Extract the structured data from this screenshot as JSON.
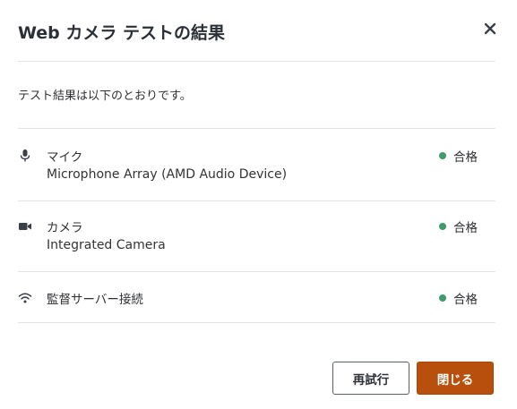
{
  "dialog": {
    "title": "Web カメラ テストの結果",
    "intro": "テスト結果は以下のとおりです。",
    "results": [
      {
        "label": "マイク",
        "device": "Microphone Array (AMD Audio Device)",
        "status": "合格",
        "icon": "microphone-icon"
      },
      {
        "label": "カメラ",
        "device": "Integrated Camera",
        "status": "合格",
        "icon": "video-camera-icon"
      },
      {
        "label": "監督サーバー接続",
        "status": "合格",
        "icon": "wifi-icon"
      }
    ],
    "buttons": {
      "retry": "再試行",
      "close": "閉じる"
    }
  },
  "colors": {
    "pass": "#3f9b6a",
    "primary": "#b84f0c",
    "divider": "#e1e3e6"
  }
}
